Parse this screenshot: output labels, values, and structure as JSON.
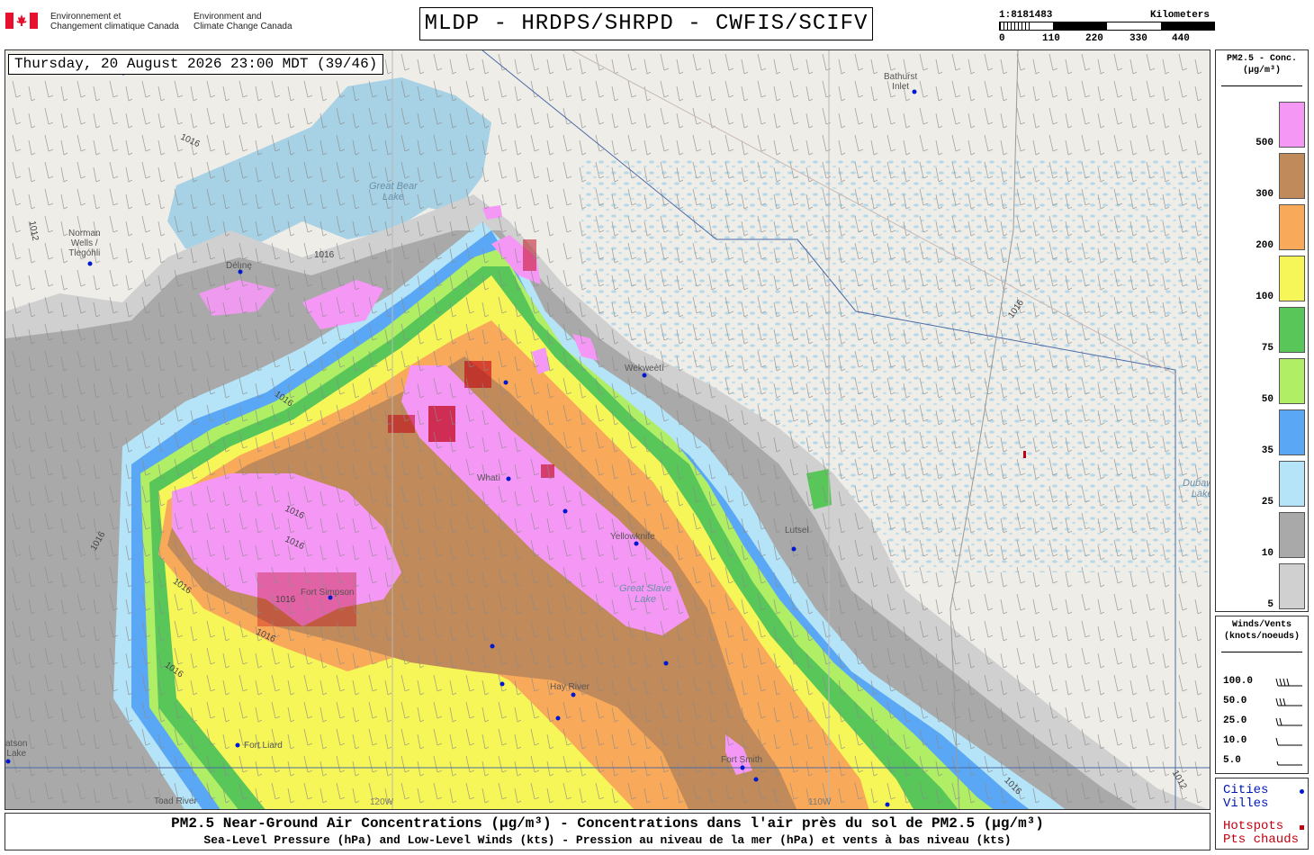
{
  "header": {
    "agency_fr": [
      "Environnement et",
      "Changement climatique Canada"
    ],
    "agency_en": [
      "Environment and",
      "Climate Change Canada"
    ],
    "title": "MLDP - HRDPS/SHRPD - CWFIS/SCIFV",
    "scale_ratio": "1:8181483",
    "scale_unit": "Kilometers",
    "scale_ticks": [
      "0",
      "110",
      "220",
      "330",
      "440"
    ]
  },
  "map": {
    "datetime": "Thursday, 20 August 2026 23:00 MDT (39/46)",
    "places": [
      {
        "name": "Bathurst Inlet",
        "lines": [
          "Bathurst",
          "Inlet"
        ]
      },
      {
        "name": "Norman Wells / Tlegóhli",
        "lines": [
          "Norman",
          "Wells /",
          "Tlegóhli"
        ]
      },
      {
        "name": "Délı̨nę",
        "lines": [
          "Délı̨nę"
        ]
      },
      {
        "name": "Wekweètì",
        "lines": [
          "Wekweètì"
        ]
      },
      {
        "name": "Whatì",
        "lines": [
          "Whatì"
        ]
      },
      {
        "name": "Yellowknife",
        "lines": [
          "Yellowknife"
        ]
      },
      {
        "name": "Lutsel",
        "lines": [
          "Lutsel"
        ]
      },
      {
        "name": "Hay River",
        "lines": [
          "Hay River"
        ]
      },
      {
        "name": "Fort Smith",
        "lines": [
          "Fort Smith"
        ]
      },
      {
        "name": "Fort Liard",
        "lines": [
          "Fort Liard"
        ]
      },
      {
        "name": "Fort Simpson",
        "lines": [
          "Fort Simpson"
        ]
      },
      {
        "name": "Toad River",
        "lines": [
          "Toad River"
        ]
      },
      {
        "name": "Watson Lake",
        "lines": [
          "atson",
          "Lake"
        ]
      }
    ],
    "lakes": [
      {
        "name": "Great Bear Lake",
        "lines": [
          "Great Bear",
          "Lake"
        ]
      },
      {
        "name": "Great Slave Lake",
        "lines": [
          "Great Slave",
          "Lake"
        ]
      },
      {
        "name": "Dubawnt Lake",
        "lines": [
          "Dubawnt",
          "Lake"
        ]
      }
    ],
    "isobar_labels": [
      "1016",
      "1012",
      "1016",
      "1016",
      "1016",
      "1016",
      "1016",
      "1016",
      "1016",
      "1016",
      "1016",
      "1016",
      "1012",
      "1016"
    ],
    "meridians": [
      "120W",
      "110W"
    ]
  },
  "legend": {
    "title": [
      "PM2.5 - Conc.",
      "(µg/m³)"
    ],
    "bins": [
      {
        "label": "500",
        "color": "#f598f5"
      },
      {
        "label": "300",
        "color": "#c08a5a"
      },
      {
        "label": "200",
        "color": "#f9a95a"
      },
      {
        "label": "100",
        "color": "#f6f658"
      },
      {
        "label": "75",
        "color": "#58c658"
      },
      {
        "label": "50",
        "color": "#b0ee65"
      },
      {
        "label": "35",
        "color": "#5aa8f5"
      },
      {
        "label": "25",
        "color": "#b5e3f7"
      },
      {
        "label": "10",
        "color": "#a9a9a9"
      },
      {
        "label": "5",
        "color": "#d0d0d0"
      }
    ]
  },
  "winds_legend": {
    "title": [
      "Winds/Vents",
      "(knots/noeuds)"
    ],
    "rows": [
      "100.0",
      "50.0",
      "25.0",
      "10.0",
      "5.0"
    ]
  },
  "markers": {
    "cities": [
      "Cities",
      "Villes"
    ],
    "hotspots": [
      "Hotspots",
      "Pts chauds"
    ],
    "city_color": "#0018d0",
    "hotspot_color": "#c00010"
  },
  "footer": {
    "line1": "PM2.5 Near-Ground Air Concentrations (µg/m³) - Concentrations dans l'air près du sol de PM2.5 (µg/m³)",
    "line2": "Sea-Level Pressure (hPa) and Low-Level Winds (kts) - Pression au niveau de la mer (hPa) et vents à bas niveau (kts)"
  }
}
